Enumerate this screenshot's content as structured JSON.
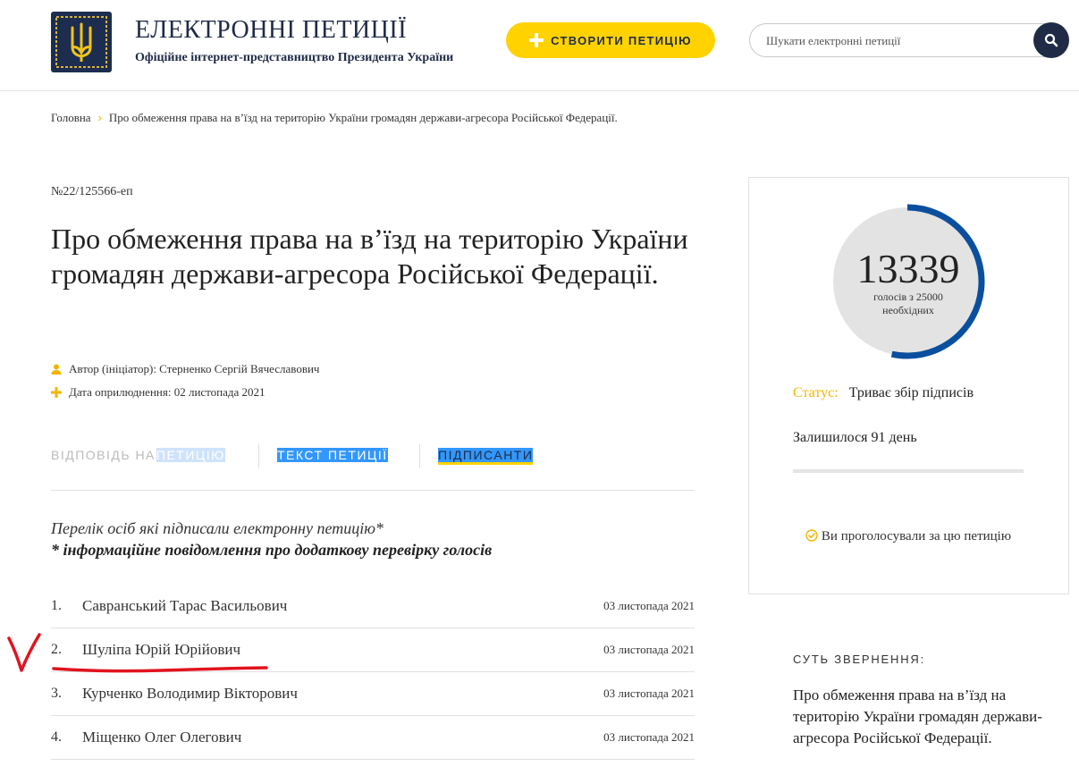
{
  "header": {
    "title": "ЕЛЕКТРОННІ ПЕТИЦІЇ",
    "subtitle": "Офіційне інтернет-представництво Президента України",
    "create_button": "СТВОРИТИ ПЕТИЦІЮ",
    "search_placeholder": "Шукати електронні петиції"
  },
  "breadcrumb": {
    "home": "Головна",
    "separator": "›",
    "current": "Про обмеження права на в’їзд на територію України громадян держави-агресора Російської Федерації."
  },
  "petition": {
    "number": "№22/125566-еп",
    "title": "Про обмеження права на в’їзд на територію України громадян держави-агресора Російської Федерації.",
    "author": "Автор (ініціатор): Стерненко Сергій Вячеславович",
    "published": "Дата оприлюднення: 02 листопада 2021"
  },
  "tabs": {
    "response_plain": "ВІДПОВІДЬ НА",
    "response_highlight": "ПЕТИЦІЮ",
    "text": "ТЕКСТ ПЕТИЦІЇ",
    "signers": "ПІДПИСАНТИ"
  },
  "signers": {
    "list_title": "Перелік осіб які підписали електронну петицію*",
    "note": "* інформаційне повідомлення про додаткову перевірку голосів",
    "rows": [
      {
        "num": "1.",
        "name": "Савранський Тарас Васильович",
        "date": "03 листопада 2021"
      },
      {
        "num": "2.",
        "name": "Шуліпа Юрій Юрійович",
        "date": "03 листопада 2021"
      },
      {
        "num": "3.",
        "name": "Курченко Володимир Вікторович",
        "date": "03 листопада 2021"
      },
      {
        "num": "4.",
        "name": "Міщенко Олег Олегович",
        "date": "03 листопада 2021"
      }
    ]
  },
  "sidebar": {
    "votes": "13339",
    "votes_needed": "голосів з 25000 необхідних",
    "vote_fraction": 0.5336,
    "status_label": "Статус:",
    "status_value": "Триває збір підписів",
    "remaining": "Залишилося 91 день",
    "voted_message": "Ви проголосували за цю петицію",
    "essence_title": "СУТЬ ЗВЕРНЕННЯ:",
    "essence_text": "Про обмеження права на в’їзд на територію України громадян держави-агресора Російської Федерації."
  },
  "colors": {
    "accent_yellow": "#ffd200",
    "navy": "#1f2b46",
    "progress_blue": "#0a4f9e",
    "gauge_bg": "#e3e3e3",
    "annotation_red": "#e0141e"
  }
}
